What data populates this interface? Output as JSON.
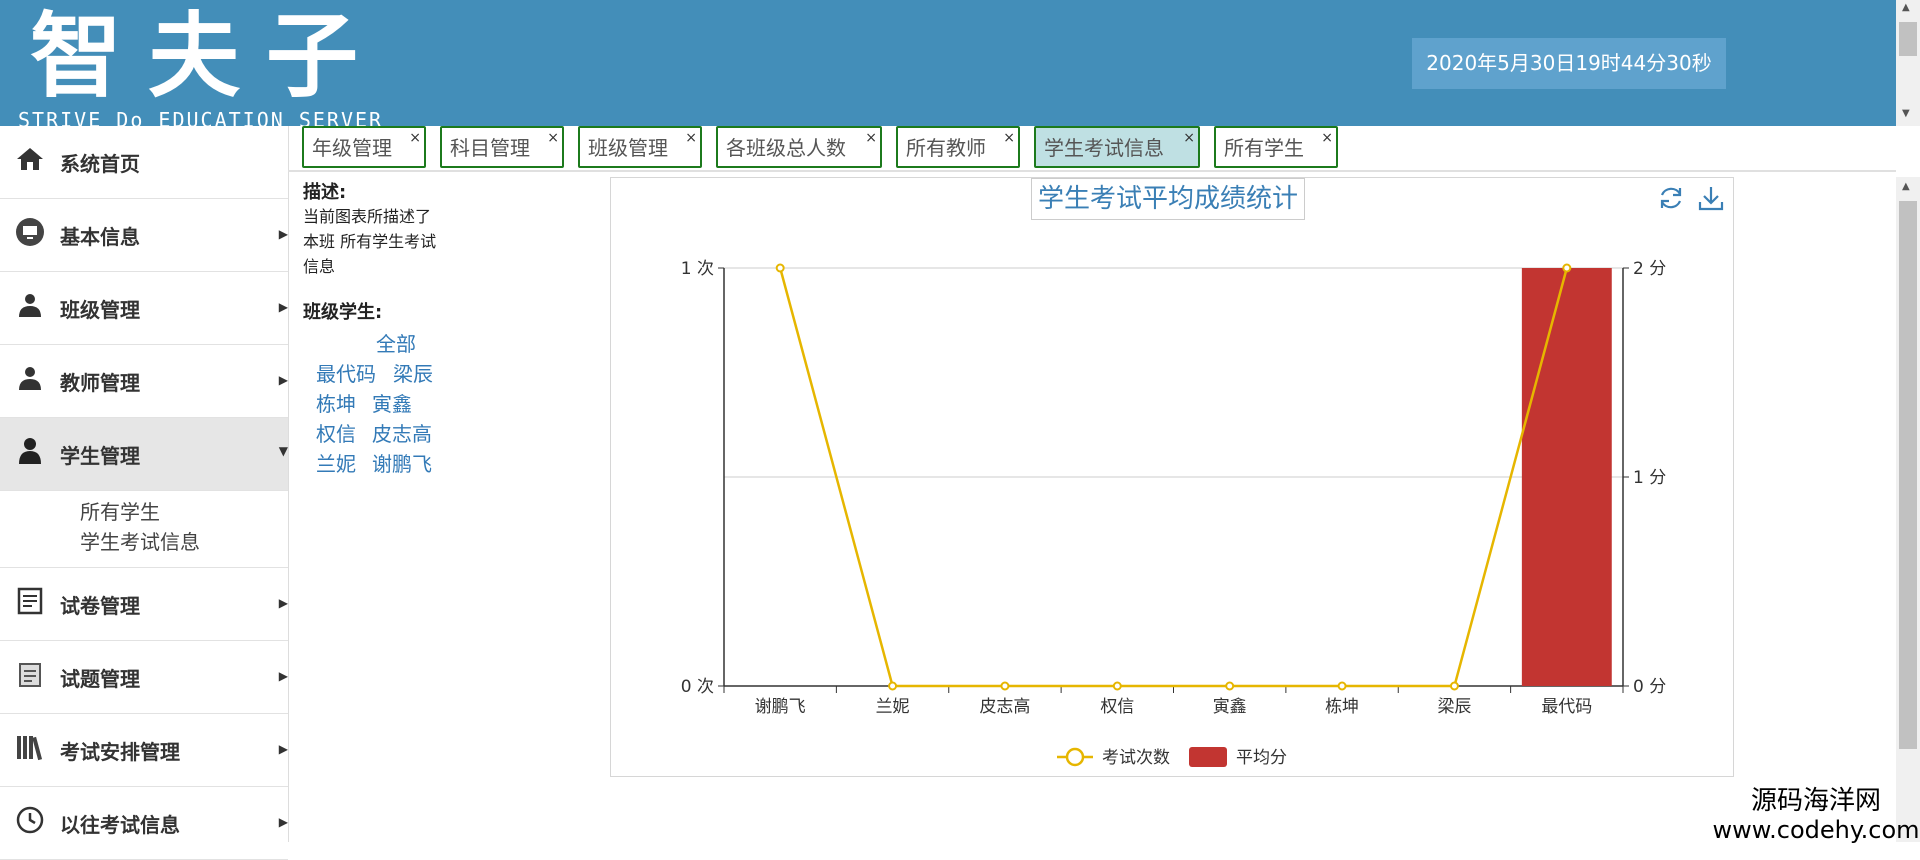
{
  "header": {
    "logo_text": "智夫子",
    "logo_subtitle": "STRIVE Do EDUCATION SERVER",
    "datetime": "2020年5月30日19时44分30秒"
  },
  "sidebar": {
    "items": [
      {
        "label": "系统首页",
        "icon": "home-icon"
      },
      {
        "label": "基本信息",
        "icon": "monitor-icon"
      },
      {
        "label": "班级管理",
        "icon": "users-icon"
      },
      {
        "label": "教师管理",
        "icon": "teacher-icon"
      },
      {
        "label": "学生管理",
        "icon": "student-icon"
      },
      {
        "label": "试卷管理",
        "icon": "paper-icon"
      },
      {
        "label": "试题管理",
        "icon": "question-icon"
      },
      {
        "label": "考试安排管理",
        "icon": "books-icon"
      },
      {
        "label": "以往考试信息",
        "icon": "clock-icon"
      }
    ],
    "submenu": [
      "所有学生",
      "学生考试信息"
    ]
  },
  "tabs": [
    {
      "label": "年级管理"
    },
    {
      "label": "科目管理"
    },
    {
      "label": "班级管理"
    },
    {
      "label": "各班级总人数"
    },
    {
      "label": "所有教师"
    },
    {
      "label": "学生考试信息"
    },
    {
      "label": "所有学生"
    }
  ],
  "tab_close": "×",
  "description": {
    "heading": "描述:",
    "lines": [
      "当前图表所描述了",
      "本班 所有学生考试",
      "信息"
    ]
  },
  "students": {
    "heading": "班级学生:",
    "all": "全部",
    "names": [
      "最代码",
      "梁辰",
      "栋坤",
      "寅鑫",
      "权信",
      "皮志高",
      "兰妮",
      "谢鹏飞"
    ]
  },
  "chart_data": {
    "type": "bar",
    "title": "学生考试平均成绩统计",
    "categories": [
      "谢鹏飞",
      "兰妮",
      "皮志高",
      "权信",
      "寅鑫",
      "栋坤",
      "梁辰",
      "最代码"
    ],
    "series": [
      {
        "name": "考试次数",
        "type": "line",
        "axis": "left",
        "color": "#e6b600",
        "values": [
          1,
          0,
          0,
          0,
          0,
          0,
          0,
          1
        ]
      },
      {
        "name": "平均分",
        "type": "bar",
        "axis": "right",
        "color": "#c23531",
        "values": [
          0,
          0,
          0,
          0,
          0,
          0,
          0,
          2
        ]
      }
    ],
    "y_left": {
      "ticks": [
        "0 次",
        "1 次"
      ],
      "range": [
        0,
        1
      ]
    },
    "y_right": {
      "ticks": [
        "0 分",
        "1 分",
        "2 分"
      ],
      "range": [
        0,
        2
      ]
    },
    "legend_position": "bottom-center",
    "grid": true
  },
  "watermark": {
    "line1": "源码海洋网",
    "line2": "www.codehy.com"
  }
}
